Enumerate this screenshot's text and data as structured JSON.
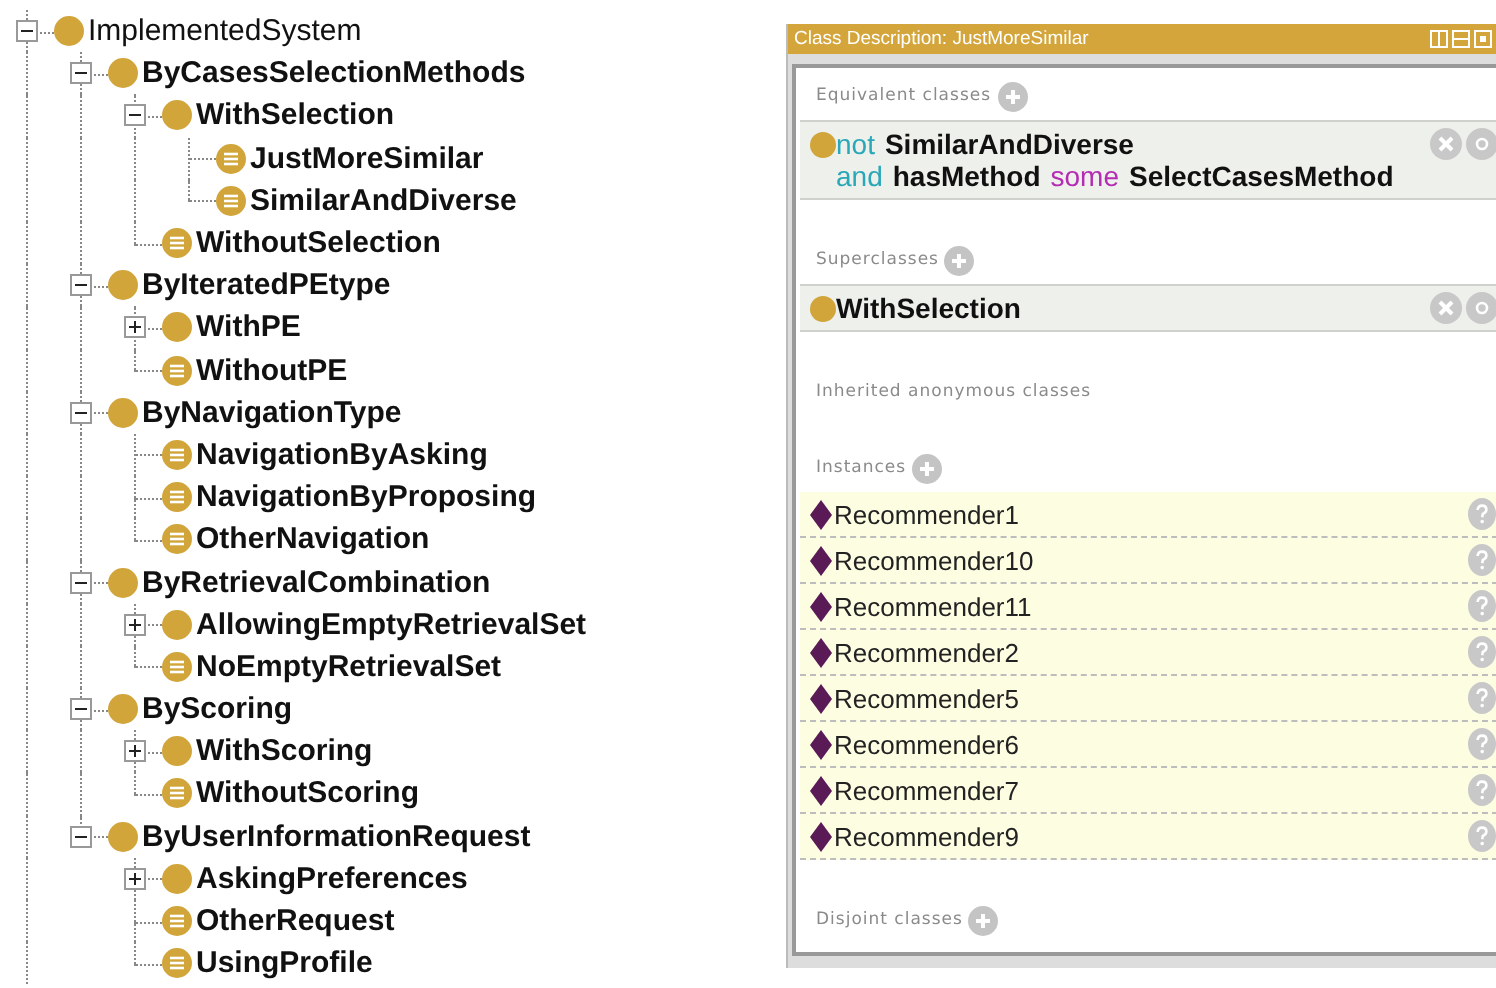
{
  "tree": {
    "label": "ImplementedSystem",
    "kind": "primitive",
    "bold": false,
    "expanded": true,
    "children": [
      {
        "label": "ByCasesSelectionMethods",
        "kind": "primitive",
        "bold": true,
        "expanded": true,
        "children": [
          {
            "label": "WithSelection",
            "kind": "primitive",
            "bold": true,
            "expanded": true,
            "children": [
              {
                "label": "JustMoreSimilar",
                "kind": "defined",
                "bold": true
              },
              {
                "label": "SimilarAndDiverse",
                "kind": "defined",
                "bold": true
              }
            ]
          },
          {
            "label": "WithoutSelection",
            "kind": "defined",
            "bold": true
          }
        ]
      },
      {
        "label": "ByIteratedPEtype",
        "kind": "primitive",
        "bold": true,
        "expanded": true,
        "children": [
          {
            "label": "WithPE",
            "kind": "primitive",
            "bold": true,
            "expanded": false
          },
          {
            "label": "WithoutPE",
            "kind": "defined",
            "bold": true
          }
        ]
      },
      {
        "label": "ByNavigationType",
        "kind": "primitive",
        "bold": true,
        "expanded": true,
        "children": [
          {
            "label": "NavigationByAsking",
            "kind": "defined",
            "bold": true
          },
          {
            "label": "NavigationByProposing",
            "kind": "defined",
            "bold": true
          },
          {
            "label": "OtherNavigation",
            "kind": "defined",
            "bold": true
          }
        ]
      },
      {
        "label": "ByRetrievalCombination",
        "kind": "primitive",
        "bold": true,
        "expanded": true,
        "children": [
          {
            "label": "AllowingEmptyRetrievalSet",
            "kind": "primitive",
            "bold": true,
            "expanded": false
          },
          {
            "label": "NoEmptyRetrievalSet",
            "kind": "defined",
            "bold": true
          }
        ]
      },
      {
        "label": "ByScoring",
        "kind": "primitive",
        "bold": true,
        "expanded": true,
        "children": [
          {
            "label": "WithScoring",
            "kind": "primitive",
            "bold": true,
            "expanded": false
          },
          {
            "label": "WithoutScoring",
            "kind": "defined",
            "bold": true
          }
        ]
      },
      {
        "label": "ByUserInformationRequest",
        "kind": "primitive",
        "bold": true,
        "expanded": true,
        "children": [
          {
            "label": "AskingPreferences",
            "kind": "primitive",
            "bold": true,
            "expanded": false
          },
          {
            "label": "OtherRequest",
            "kind": "defined",
            "bold": true
          },
          {
            "label": "UsingProfile",
            "kind": "defined",
            "bold": true
          }
        ]
      }
    ]
  },
  "class_description": {
    "title": "Class Description: JustMoreSimilar",
    "sections": [
      {
        "title": "Equivalent classes",
        "kind": "expressions",
        "add_button": true,
        "items": [
          {
            "lines": [
              [
                {
                  "text": "not",
                  "kind": "keyword"
                },
                {
                  "text": "SimilarAndDiverse",
                  "kind": "name"
                }
              ],
              [
                {
                  "text": "and",
                  "kind": "keyword"
                },
                {
                  "text": "hasMethod",
                  "kind": "name"
                },
                {
                  "text": "some",
                  "kind": "quantifier"
                },
                {
                  "text": "SelectCasesMethod",
                  "kind": "name"
                }
              ]
            ]
          }
        ]
      },
      {
        "title": "Superclasses",
        "kind": "expressions",
        "add_button": true,
        "items": [
          {
            "lines": [
              [
                {
                  "text": "WithSelection",
                  "kind": "name"
                }
              ]
            ]
          }
        ]
      },
      {
        "title": "Inherited anonymous classes",
        "kind": "expressions",
        "add_button": false
      },
      {
        "title": "Instances",
        "kind": "individuals",
        "add_button": true,
        "items": [
          {
            "label": "Recommender1"
          },
          {
            "label": "Recommender10"
          },
          {
            "label": "Recommender11"
          },
          {
            "label": "Recommender2"
          },
          {
            "label": "Recommender5"
          },
          {
            "label": "Recommender6"
          },
          {
            "label": "Recommender7"
          },
          {
            "label": "Recommender9"
          }
        ]
      },
      {
        "title": "Disjoint classes",
        "kind": "expressions",
        "add_button": true
      }
    ]
  }
}
